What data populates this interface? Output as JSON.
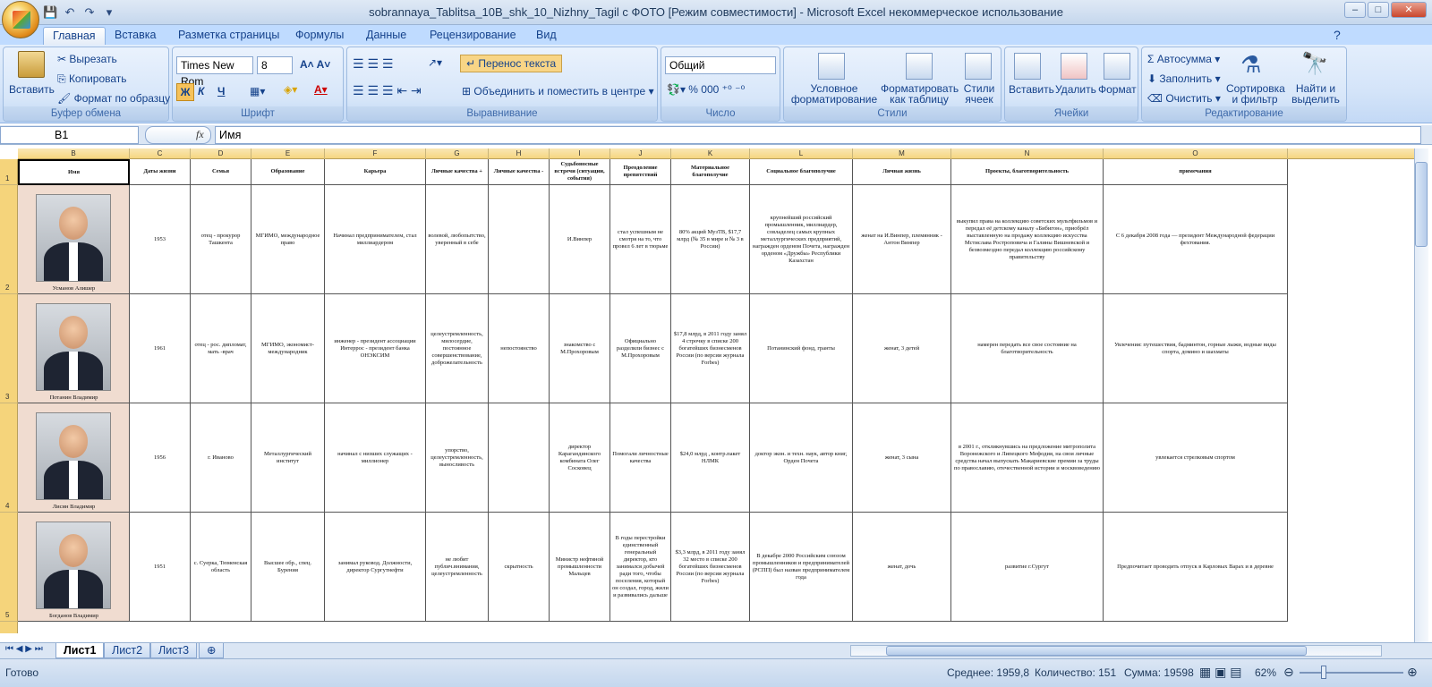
{
  "window": {
    "title": "sobrannaya_Tablitsa_10B_shk_10_Nizhny_Tagil с ФОТО  [Режим совместимости] - Microsoft Excel некоммерческое использование",
    "minimize": "–",
    "maximize": "□",
    "close": "✕"
  },
  "tabs": [
    "Главная",
    "Вставка",
    "Разметка страницы",
    "Формулы",
    "Данные",
    "Рецензирование",
    "Вид"
  ],
  "ribbon": {
    "clipboard": {
      "label": "Буфер обмена",
      "paste": "Вставить",
      "cut": "Вырезать",
      "copy": "Копировать",
      "format_painter": "Формат по образцу"
    },
    "font": {
      "label": "Шрифт",
      "name": "Times New Rom",
      "size": "8",
      "bold": "Ж",
      "italic": "К",
      "underline": "Ч"
    },
    "alignment": {
      "label": "Выравнивание",
      "wrap": "Перенос текста",
      "merge": "Объединить и поместить в центре"
    },
    "number": {
      "label": "Число",
      "format": "Общий"
    },
    "styles": {
      "label": "Стили",
      "conditional": "Условное форматирование",
      "as_table": "Форматировать как таблицу",
      "cell_styles": "Стили ячеек"
    },
    "cells": {
      "label": "Ячейки",
      "insert": "Вставить",
      "delete": "Удалить",
      "format": "Формат"
    },
    "editing": {
      "label": "Редактирование",
      "autosum": "Автосумма",
      "fill": "Заполнить",
      "clear": "Очистить",
      "sort": "Сортировка и фильтр",
      "find": "Найти и выделить"
    }
  },
  "formula_bar": {
    "name_box": "B1",
    "fx": "fx",
    "content": "Имя"
  },
  "columns": [
    "B",
    "C",
    "D",
    "E",
    "F",
    "G",
    "H",
    "I",
    "J",
    "K",
    "L",
    "M",
    "N",
    "O"
  ],
  "rows": [
    "1",
    "2",
    "3",
    "4",
    "5"
  ],
  "headers": [
    "Имя",
    "Даты жизни",
    "Семья",
    "Образование",
    "Карьера",
    "Личные качества +",
    "Личные качества -",
    "Судьбоносные встречи (ситуации, события)",
    "Преодоление препятствий",
    "Материальное благополучие",
    "Социальное благополучие",
    "Личная жизнь",
    "Проекты, благотворительность",
    "примечания"
  ],
  "people": [
    {
      "name": "Усманов Алишер",
      "cells": [
        "1953",
        "отец - прокурор Ташкента",
        "МГИМО, международное право",
        "Начинал предпринимателем, стал миллиардером",
        "волевой, любопытство, уверенный в себе",
        "",
        "И.Винпер",
        "стал успешным не смотря на то, что провел 6 лет в тюрьме",
        "80% акций МузТВ, $17,7 млрд (№ 35 в мире и № 3 в России)",
        "крупнейший российский промышленник, миллиардер, совладелец самых крупных металлургических предприятий, награжден орденом Почета, награжден орденом «Дружбы» Республики Казахстан",
        "женат на И.Винпер, племянник - Антон Винпер",
        "выкупил права на коллекцию советских мультфильмов и передал её детскому каналу «Бибигон», приобрёл выставленную на продажу коллекцию искусства Мстислава Ростроповича и Галины Вишневской и безвозмездно передал коллекцию российскому правительству",
        "С 6 декабря 2008 года — президент Международной федерации фехтования."
      ]
    },
    {
      "name": "Потанин Владимир",
      "cells": [
        "1961",
        "отец - рос. дипломат, мать -врач",
        "МГИМО, экономист-международник",
        "инженер - президент ассоциации Интеррос - президент банка ОНЭКСИМ",
        "целеустремленность, милосердие, постоянное совершенствование, доброжелательность",
        "непостоянство",
        "знакомство с М.Прохоровым",
        "Официально разделили бизнес с М.Прохоровым",
        "$17,8 млрд, в 2011 году занял 4 строчку в списке 200 богатейших бизнесменов России (по версии журнала Forbes)",
        "Потанинский фонд, гранты",
        "женат, 3 детей",
        "намерен передать все свое состояние на благотворительность",
        "Увлечения: путешествия, бадминтон, горные лыжи, водные виды спорта, домино и шахматы"
      ]
    },
    {
      "name": "Лисин Владимир",
      "cells": [
        "1956",
        "г. Иваново",
        "Металлургический институт",
        "начинал с низших служащих - миллионер",
        "упорство, целеустремленность, выносливость",
        "",
        "директор Карагандинского комбината Олег Сосковец",
        "Помогали личностные качества",
        "$24,0 млрд , контр.пакет НЛМК",
        "доктор экон. и техн. наук, автор книг, Орден Почета",
        "женат, 3 сына",
        "в 2001 г., откликнувшись на предложение митрополита Воронежского и Липецкого Мефодия, на свои личные средства начал выпускать Макариевские премии за труды по православию, отечественной истории и москвоведению",
        "увлекается стрелковым спортом"
      ]
    },
    {
      "name": "Богданов Владимир",
      "cells": [
        "1951",
        "с. Суерка, Тюменская область",
        "Высшее обр., спец. Бурения",
        "занимал руковод. Должности, директор Сургутнефти",
        "не любит публич.внимания, целеустремленность",
        "скрытность",
        "Министр нефтяной промышленности Мальцев",
        "В годы перестройки единственный генеральный директор, кто занимался добычей ради того, чтобы поселения, который он создал, город, жили и развивались дальше",
        "$3,3 млрд, в 2011 году занял 32 место в списке 200 богатейших бизнесменов России (по версии журнала Forbes)",
        "В декабре 2000 Российским союзом промышленников и предпринимателей (РСПП) был назван предпринимателем года",
        "женат, дочь",
        "развитие г.Сургут",
        "Предпочитает проводить отпуск в Карловых Варах и в деревне"
      ]
    }
  ],
  "sheets": [
    "Лист1",
    "Лист2",
    "Лист3"
  ],
  "status": {
    "ready": "Готово",
    "average": "Среднее: 1959,8",
    "count": "Количество: 151",
    "sum": "Сумма: 19598",
    "zoom": "62%"
  }
}
